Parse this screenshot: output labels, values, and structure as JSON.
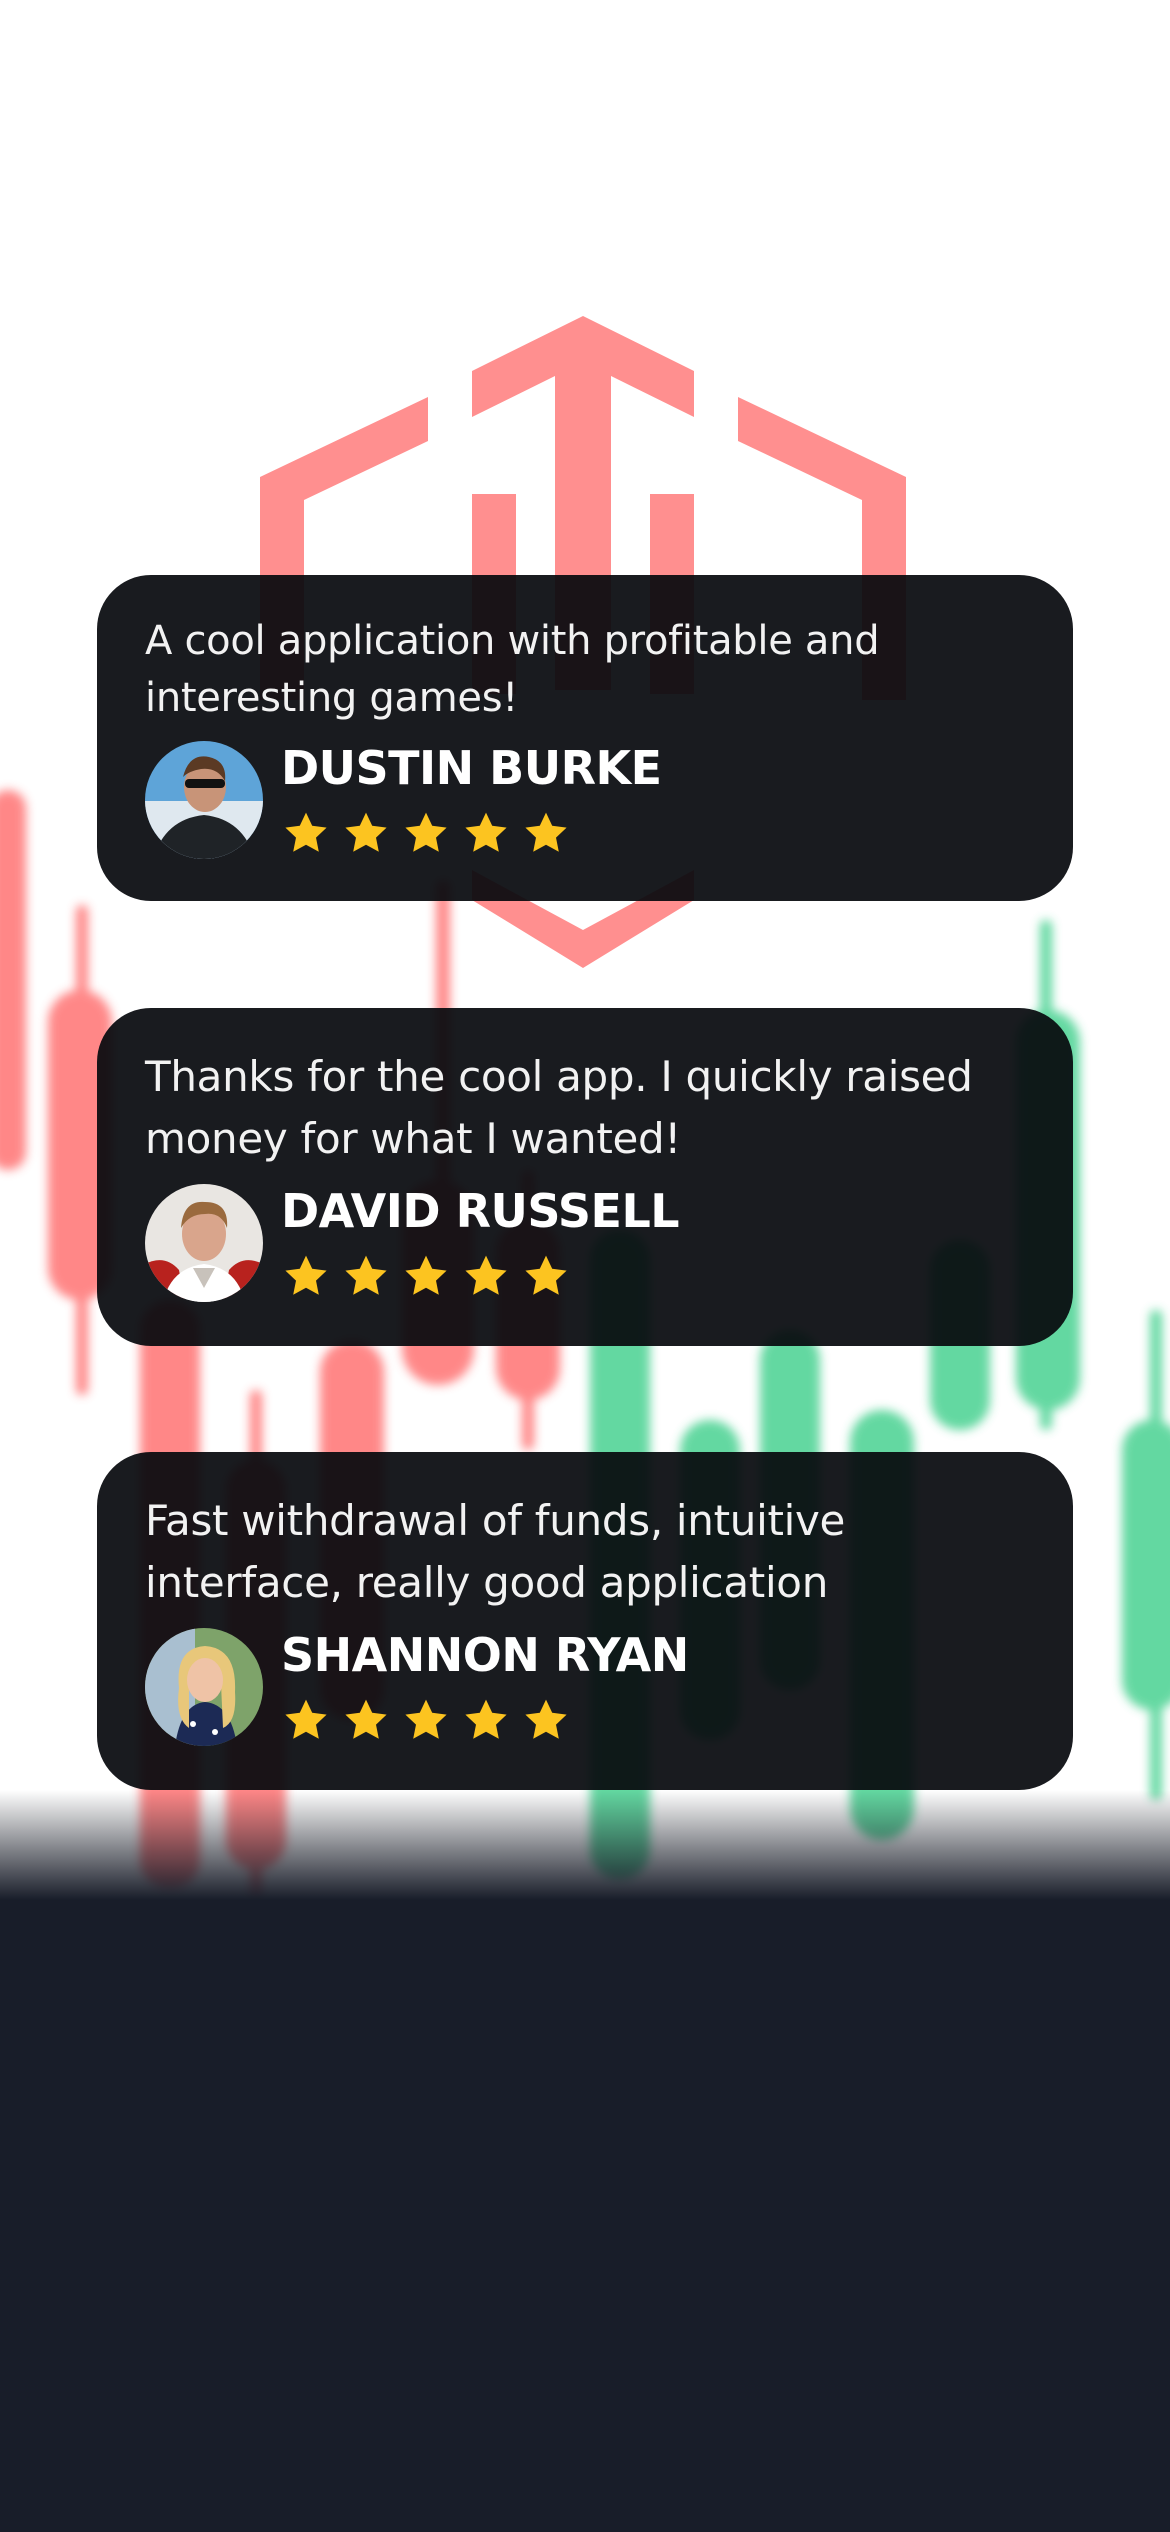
{
  "colors": {
    "card_bg": "#080a0e",
    "star": "#fcc420",
    "candle_red": "#ff6b6b",
    "candle_green": "#3ccf8a",
    "logo": "#ff8f8f",
    "bottom_panel": "#181d29"
  },
  "icons": {
    "logo": "hexagon-logo-icon",
    "star": "star-icon"
  },
  "reviews": [
    {
      "text": "A cool application with profitable and interesting games!",
      "author": "DUSTIN BURKE",
      "rating": 5,
      "avatar": "avatar-man-sunglasses"
    },
    {
      "text": "Thanks for the cool app. I quickly raised money for what I wanted!",
      "author": "DAVID RUSSELL",
      "rating": 5,
      "avatar": "avatar-young-man"
    },
    {
      "text": "Fast withdrawal of funds, intuitive interface, really good application",
      "author": "SHANNON RYAN",
      "rating": 5,
      "avatar": "avatar-blonde-woman"
    }
  ]
}
